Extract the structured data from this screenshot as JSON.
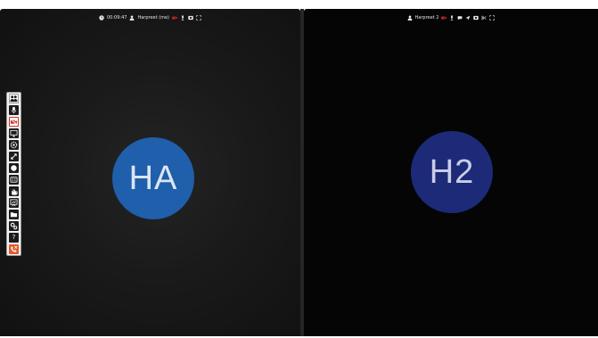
{
  "left_participant": {
    "timer": "00:09:47",
    "name": "Harpreet (me)",
    "initials": "HA",
    "avatar_color": "#1f5fab",
    "topbar_icons": [
      "clock-icon",
      "user-icon",
      "video-off-icon",
      "mic-icon",
      "settings-icon",
      "fullscreen-icon"
    ]
  },
  "right_participant": {
    "name": "Harpreet 2",
    "initials": "H2",
    "avatar_color": "#1d2a78",
    "topbar_icons": [
      "user-icon",
      "video-off-icon",
      "mic-icon",
      "chat-icon",
      "send-icon",
      "settings-icon",
      "scissors-icon",
      "fullscreen-icon"
    ]
  },
  "toolbar": {
    "buttons": [
      {
        "name": "participants-button",
        "icon": "people-icon"
      },
      {
        "name": "microphone-button",
        "icon": "mic-icon"
      },
      {
        "name": "camera-off-button",
        "icon": "video-off-icon",
        "state": "off"
      },
      {
        "name": "screen-share-button",
        "icon": "monitor-icon"
      },
      {
        "name": "settings-button",
        "icon": "gear-icon"
      },
      {
        "name": "fullscreen-button",
        "icon": "expand-icon"
      },
      {
        "name": "record-button",
        "icon": "record-icon"
      },
      {
        "name": "closed-captions-button",
        "icon": "cc-icon"
      },
      {
        "name": "raise-hand-button",
        "icon": "hand-icon"
      },
      {
        "name": "whiteboard-button",
        "icon": "whiteboard-icon"
      },
      {
        "name": "files-button",
        "icon": "folder-icon"
      },
      {
        "name": "options-button",
        "icon": "cogs-icon"
      },
      {
        "name": "help-button",
        "icon": "question-icon",
        "label": "?"
      },
      {
        "name": "hang-up-button",
        "icon": "phone-hangup-icon"
      }
    ]
  },
  "colors": {
    "background": "#0b0b0b",
    "toolbar_bg": "#f2f2f2",
    "toolbar_icon": "#1c1c1c",
    "danger": "#e0302a",
    "hangup": "#e35a2a"
  }
}
